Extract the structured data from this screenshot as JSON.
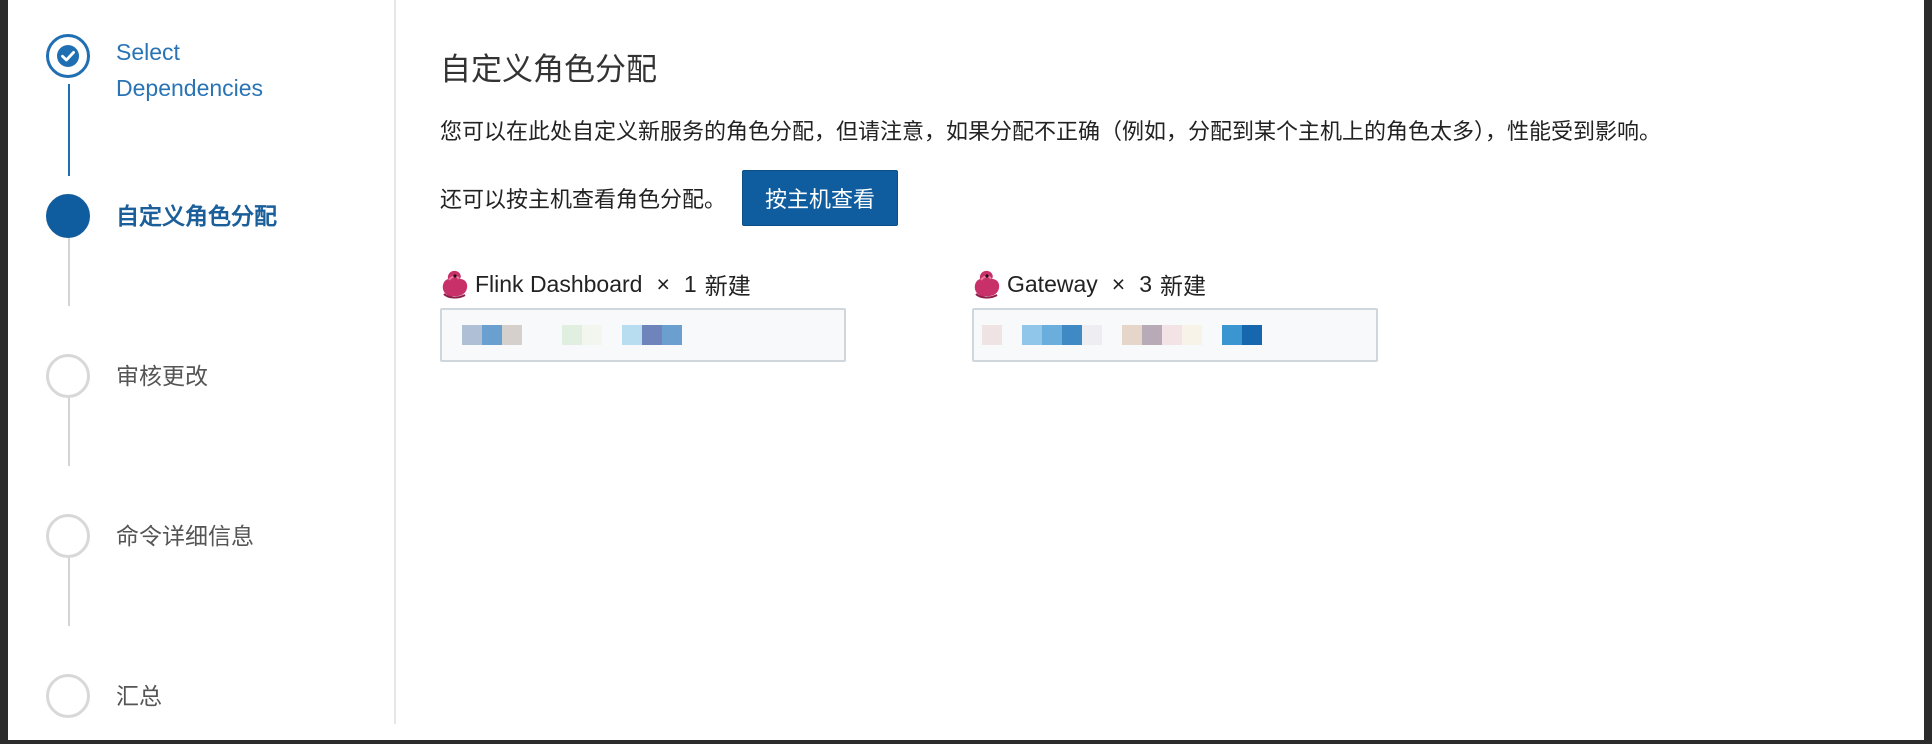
{
  "steps": [
    {
      "label": "Select Dependencies",
      "state": "done"
    },
    {
      "label": "自定义角色分配",
      "state": "active"
    },
    {
      "label": "审核更改",
      "state": "pending"
    },
    {
      "label": "命令详细信息",
      "state": "pending"
    },
    {
      "label": "汇总",
      "state": "pending"
    }
  ],
  "main": {
    "title": "自定义角色分配",
    "description": "您可以在此处自定义新服务的角色分配，但请注意，如果分配不正确（例如，分配到某个主机上的角色太多），性能受到影响。",
    "host_view_text": "还可以按主机查看角色分配。",
    "host_view_button": "按主机查看"
  },
  "roles": [
    {
      "name": "Flink Dashboard",
      "times": "×",
      "count": "1",
      "status": "新建",
      "icon": "flink-squirrel-icon"
    },
    {
      "name": "Gateway",
      "times": "×",
      "count": "3",
      "status": "新建",
      "icon": "flink-squirrel-icon"
    }
  ],
  "colors": {
    "accent": "#0f5d9e",
    "done": "#2a74b5",
    "pending_border": "#d8d8d8"
  }
}
